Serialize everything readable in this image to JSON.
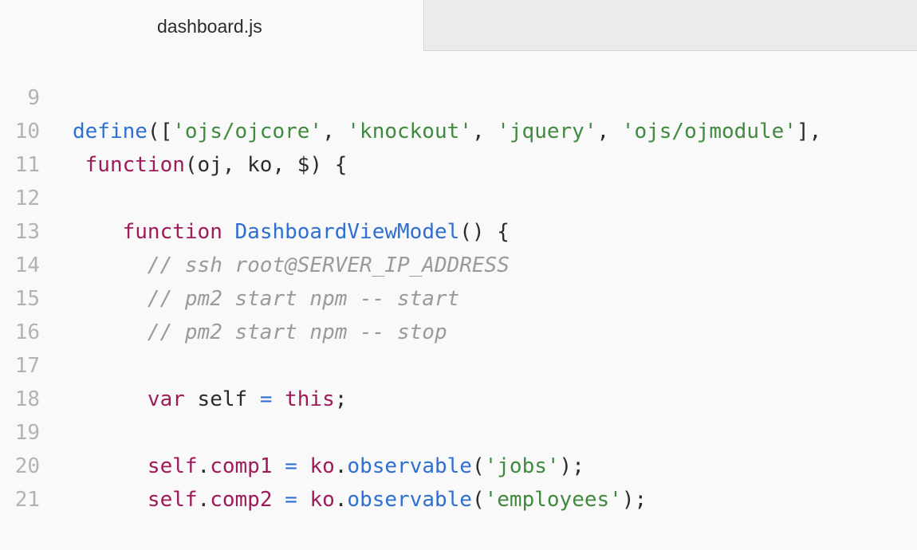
{
  "tab": {
    "title": "dashboard.js"
  },
  "lines": [
    {
      "num": "9",
      "text": "define(['ojs/ojcore', 'knockout', 'jquery', 'ojs/ojmodule'],"
    },
    {
      "num": "10",
      "text": " function(oj, ko, $) {"
    },
    {
      "num": "11",
      "text": ""
    },
    {
      "num": "12",
      "text": "    function DashboardViewModel() {"
    },
    {
      "num": "13",
      "text": "      // ssh root@SERVER_IP_ADDRESS"
    },
    {
      "num": "14",
      "text": "      // pm2 start npm -- start"
    },
    {
      "num": "15",
      "text": "      // pm2 start npm -- stop"
    },
    {
      "num": "16",
      "text": ""
    },
    {
      "num": "17",
      "text": "      var self = this;"
    },
    {
      "num": "18",
      "text": ""
    },
    {
      "num": "19",
      "text": "      self.comp1 = ko.observable('jobs');"
    },
    {
      "num": "20",
      "text": "      self.comp2 = ko.observable('employees');"
    },
    {
      "num": "21",
      "text": ""
    }
  ]
}
